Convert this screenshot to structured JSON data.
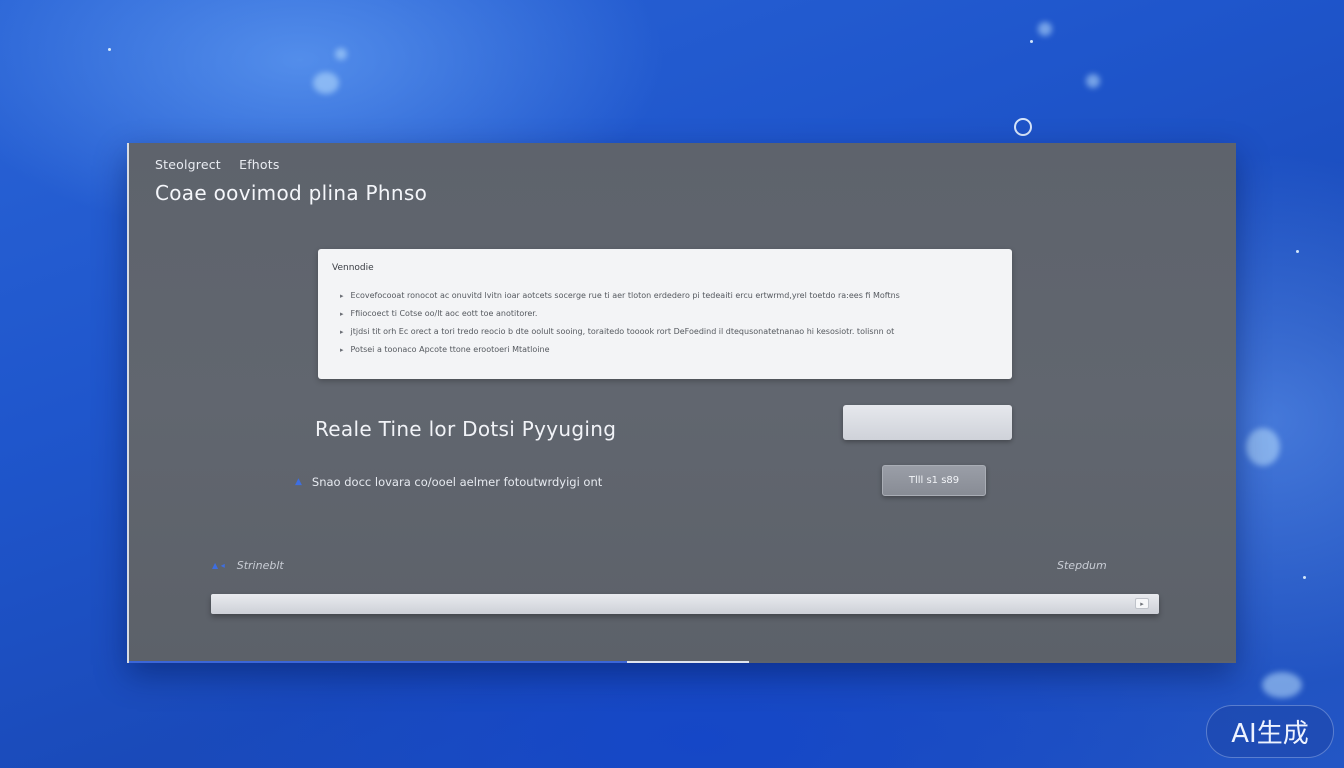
{
  "breadcrumb": {
    "items": [
      "Steolgrect",
      "Efhots"
    ]
  },
  "page": {
    "title": "Coae oovimod plina Phnso"
  },
  "info_card": {
    "heading": "Vennodie",
    "items": [
      "Ecovefocooat ronocot ac onuvitd lvitn ioar aotcets socerge rue ti aer tloton erdedero pi tedeaiti ercu ertwrmd,yrel toetdo ra:ees fi Moftns",
      "Ffiiocoect ti Cotse oo/lt aoc eott toe anotitorer.",
      "jtjdsi tit orh Ec orect a tori tredo reocio b dte oolult sooing, toraitedo tooook rort DeFoedind il dtequsonatetnanao hi kesosiotr. tolisnn ot",
      "Potsei a toonaco Apcote ttone erootoeri Mtatloine"
    ]
  },
  "section": {
    "heading": "Reale Tine lor Dotsi Pyyuging",
    "status_text": "Snao docc lovara co/ooel aelmer fotoutwrdyigi ont",
    "button_label": "Tlll s1 s89"
  },
  "footer": {
    "left_label": "Strineblt",
    "right_label": "Stepdum"
  },
  "watermark": {
    "text": "AI生成"
  },
  "colors": {
    "accent": "#3e6ee0",
    "window": "#5f646d",
    "background": "#1f56cc"
  }
}
